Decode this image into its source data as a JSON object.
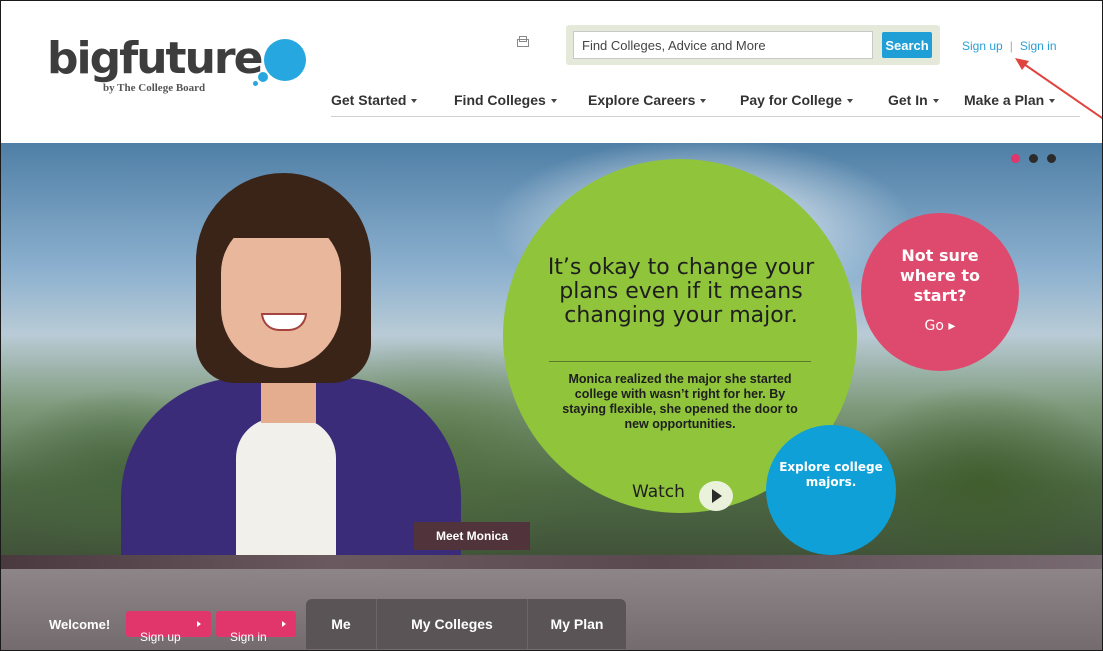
{
  "logo": {
    "wordmark": "bigfuture",
    "byline": "by The College Board"
  },
  "search": {
    "placeholder": "Find Colleges, Advice and More",
    "button_label": "Search"
  },
  "auth": {
    "sign_up": "Sign up",
    "separator": "|",
    "sign_in": "Sign in"
  },
  "nav": {
    "items": [
      {
        "label": "Get Started"
      },
      {
        "label": "Find Colleges"
      },
      {
        "label": "Explore Careers"
      },
      {
        "label": "Pay for College"
      },
      {
        "label": "Get In"
      },
      {
        "label": "Make a Plan"
      }
    ]
  },
  "hero": {
    "headline": "It’s okay to change your plans even if it means changing your major.",
    "body": "Monica realized the major she started college with wasn’t right for her. By staying flexible, she opened the door to new opportunities.",
    "watch_label": "Watch",
    "cta_pink": {
      "text": "Not sure where to start?",
      "go": "Go ▸"
    },
    "cta_blue": {
      "text": "Explore college majors."
    },
    "meet_tag": "Meet Monica",
    "carousel": {
      "active_index": 0,
      "count": 3
    }
  },
  "bottom_bar": {
    "welcome": "Welcome!",
    "sign_up_button": "Sign up",
    "sign_in_button": "Sign in",
    "tabs": [
      {
        "label": "Me"
      },
      {
        "label": "My Colleges"
      },
      {
        "label": "My Plan"
      }
    ]
  },
  "colors": {
    "brand_blue": "#27a7e0",
    "search_blue": "#1f9fd6",
    "link_blue": "#2a9fd6",
    "green_circle": "#8fc43b",
    "pink_circle": "#de4a6d",
    "blue_circle": "#0fa0d8",
    "pink_button": "#e0366b",
    "annotation_arrow": "#e0443f"
  }
}
